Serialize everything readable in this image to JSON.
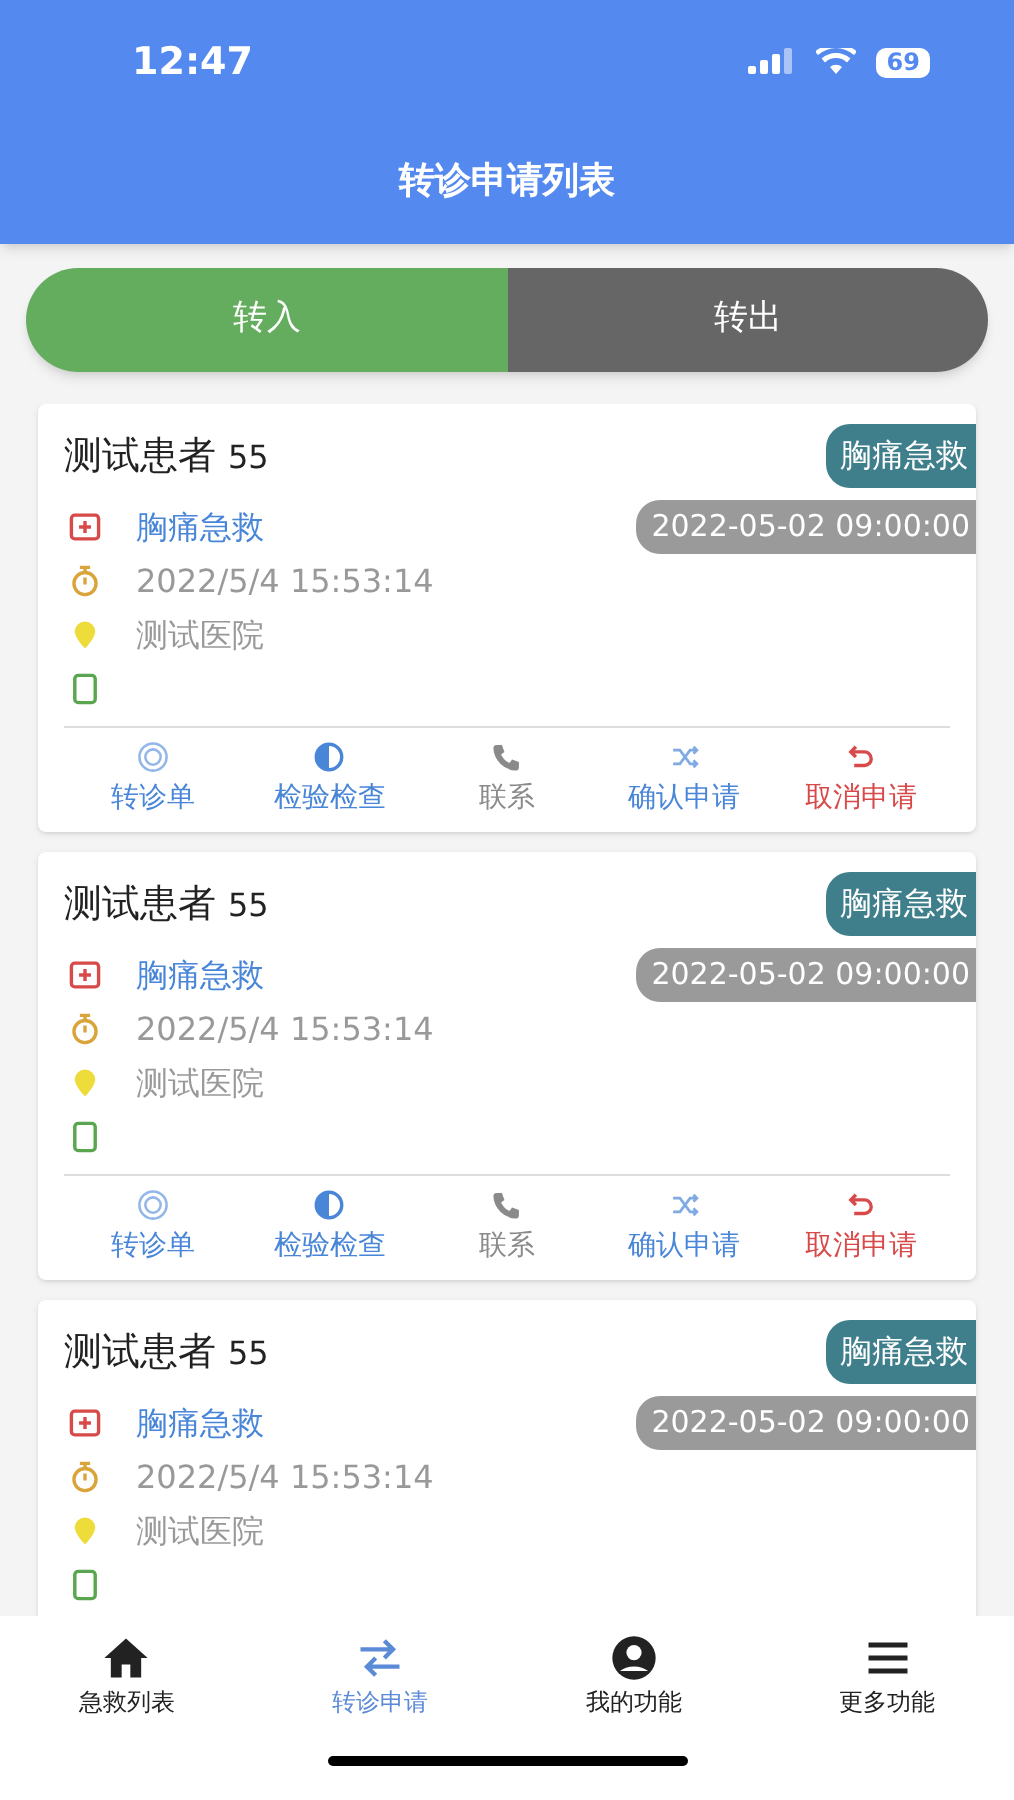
{
  "status_bar": {
    "time": "12:47",
    "battery": "69"
  },
  "header": {
    "title": "转诊申请列表"
  },
  "segments": [
    {
      "label": "转入",
      "selected": true
    },
    {
      "label": "转出",
      "selected": false
    }
  ],
  "cards": [
    {
      "name": "测试患者",
      "age": "55",
      "tag": "胸痛急救",
      "diagnosis": "胸痛急救",
      "date": "2022-05-02 09:00:00",
      "time": "2022/5/4 15:53:14",
      "hospital": "测试医院",
      "actions": [
        {
          "kind": "form",
          "label": "转诊单",
          "color": "#4a86d8"
        },
        {
          "kind": "test",
          "label": "检验检查",
          "color": "#4a86d8"
        },
        {
          "kind": "phone",
          "label": "联系",
          "color": "#8a8a8a"
        },
        {
          "kind": "confirm",
          "label": "确认申请",
          "color": "#4a86d8"
        },
        {
          "kind": "cancel",
          "label": "取消申请",
          "color": "#d84a4a"
        }
      ]
    },
    {
      "name": "测试患者",
      "age": "55",
      "tag": "胸痛急救",
      "diagnosis": "胸痛急救",
      "date": "2022-05-02 09:00:00",
      "time": "2022/5/4 15:53:14",
      "hospital": "测试医院",
      "actions": [
        {
          "kind": "form",
          "label": "转诊单",
          "color": "#4a86d8"
        },
        {
          "kind": "test",
          "label": "检验检查",
          "color": "#4a86d8"
        },
        {
          "kind": "phone",
          "label": "联系",
          "color": "#8a8a8a"
        },
        {
          "kind": "confirm",
          "label": "确认申请",
          "color": "#4a86d8"
        },
        {
          "kind": "cancel",
          "label": "取消申请",
          "color": "#d84a4a"
        }
      ]
    },
    {
      "name": "测试患者",
      "age": "55",
      "tag": "胸痛急救",
      "diagnosis": "胸痛急救",
      "date": "2022-05-02 09:00:00",
      "time": "2022/5/4 15:53:14",
      "hospital": "测试医院"
    }
  ],
  "bottom_nav": [
    {
      "kind": "home",
      "label": "急救列表",
      "selected": false
    },
    {
      "kind": "transfer",
      "label": "转诊申请",
      "selected": true
    },
    {
      "kind": "profile",
      "label": "我的功能",
      "selected": false
    },
    {
      "kind": "menu",
      "label": "更多功能",
      "selected": false
    }
  ]
}
